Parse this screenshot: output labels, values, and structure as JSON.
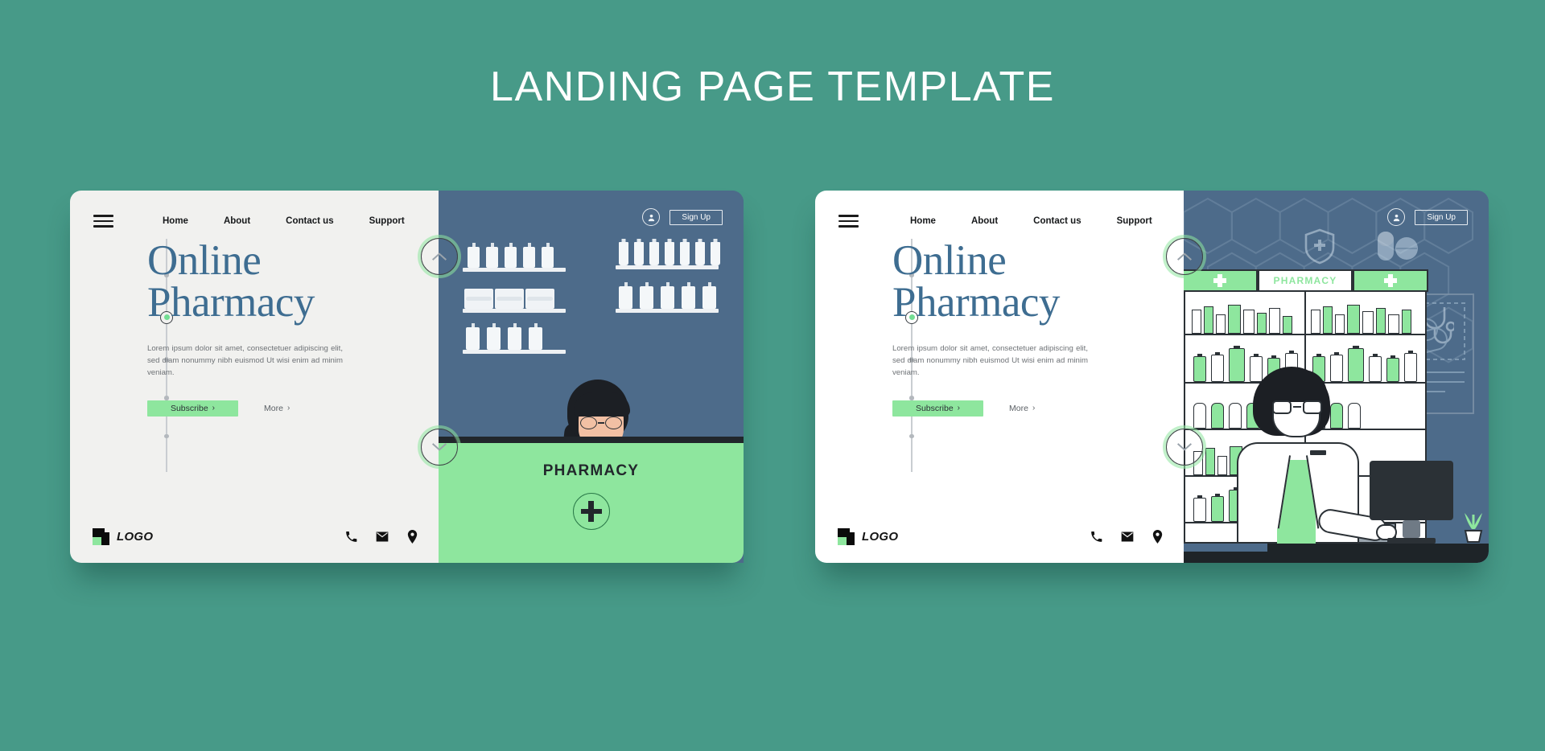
{
  "page": {
    "title": "LANDING PAGE TEMPLATE",
    "background_color": "#479a88"
  },
  "colors": {
    "background": "#479a88",
    "accent_green": "#8ee69e",
    "heading_blue": "#3e6d91",
    "illustration_blue": "#4d6b8a",
    "dark": "#2b3136",
    "card_a_bg": "#f1f1ef",
    "card_b_bg": "#ffffff"
  },
  "cards": [
    {
      "id": "card-a",
      "nav": {
        "menu_icon": "hamburger-menu-icon",
        "links": [
          {
            "label": "Home"
          },
          {
            "label": "About"
          },
          {
            "label": "Contact us"
          },
          {
            "label": "Support"
          }
        ]
      },
      "hero": {
        "title_line1": "Online",
        "title_line2": "Pharmacy",
        "body": "Lorem ipsum dolor sit amet, consectetuer adipiscing elit, sed diam nonummy nibh euismod Ut wisi enim ad minim veniam.",
        "primary_button": "Subscribe",
        "primary_button_chevron": "›",
        "secondary_button": "More",
        "secondary_button_chevron": "›"
      },
      "rail": {
        "dots": 5,
        "active_index": 1
      },
      "arrows": {
        "up": "chevron-up-icon",
        "down": "chevron-down-icon"
      },
      "account": {
        "avatar_icon": "user-avatar-icon",
        "signup_label": "Sign Up"
      },
      "footer": {
        "logo_text": "LOGO",
        "icons": [
          "phone-icon",
          "envelope-icon",
          "location-pin-icon"
        ]
      },
      "illustration": {
        "type": "pharmacist-behind-counter",
        "counter_label": "PHARMACY",
        "counter_symbol": "plus-icon",
        "background_color": "#4d6b8a",
        "counter_color": "#8ee69e"
      }
    },
    {
      "id": "card-b",
      "nav": {
        "menu_icon": "hamburger-menu-icon",
        "links": [
          {
            "label": "Home"
          },
          {
            "label": "About"
          },
          {
            "label": "Contact us"
          },
          {
            "label": "Support"
          }
        ]
      },
      "hero": {
        "title_line1": "Online",
        "title_line2": "Pharmacy",
        "body": "Lorem ipsum dolor sit amet, consectetuer adipiscing elit, sed diam nonummy nibh euismod Ut wisi enim ad minim veniam.",
        "primary_button": "Subscribe",
        "primary_button_chevron": "›",
        "secondary_button": "More",
        "secondary_button_chevron": "›"
      },
      "rail": {
        "dots": 5,
        "active_index": 1
      },
      "arrows": {
        "up": "chevron-up-icon",
        "down": "chevron-down-icon"
      },
      "account": {
        "avatar_icon": "user-avatar-icon",
        "signup_label": "Sign Up"
      },
      "footer": {
        "logo_text": "LOGO",
        "icons": [
          "phone-icon",
          "envelope-icon",
          "location-pin-icon"
        ]
      },
      "illustration": {
        "type": "pharmacy-shop-line-art",
        "shop_sign": "PHARMACY",
        "sign_cross_left": "cross-icon",
        "sign_cross_right": "cross-icon",
        "background_color": "#4d6b8a",
        "pattern": "hexagon-medical-pattern",
        "medical_icons": [
          "shield-cross-icon",
          "capsule-pill-icon",
          "tablet-pill-icon",
          "droplet-icon",
          "heart-ecg-icon",
          "stethoscope-icon"
        ]
      }
    }
  ]
}
